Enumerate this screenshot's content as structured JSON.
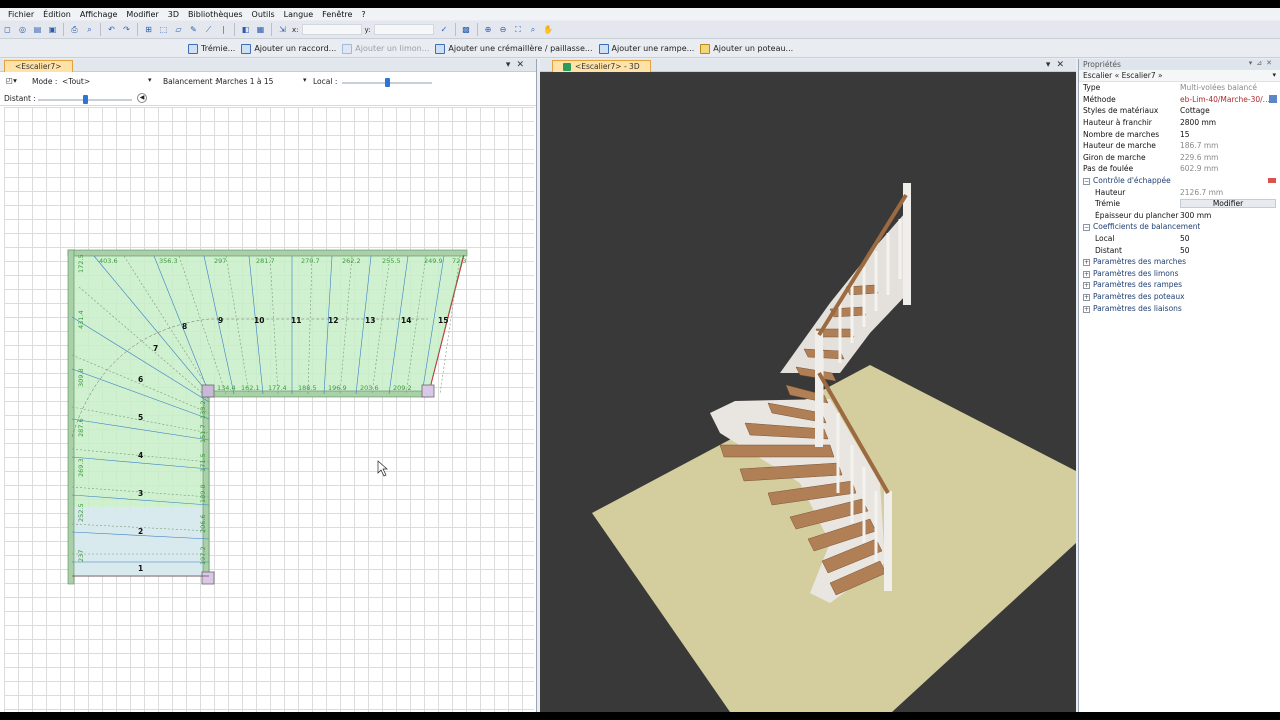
{
  "menu": [
    "Fichier",
    "Édition",
    "Affichage",
    "Modifier",
    "3D",
    "Bibliothèques",
    "Outils",
    "Langue",
    "Fenêtre",
    "?"
  ],
  "toolbar": {
    "x_label": "x:",
    "y_label": "y:"
  },
  "toolbar2": {
    "tremie": "Trémie...",
    "raccord": "Ajouter un raccord...",
    "limon": "Ajouter un limon...",
    "cremaillere": "Ajouter une crémaillère / paillasse...",
    "rampe": "Ajouter une rampe...",
    "poteau": "Ajouter un poteau..."
  },
  "left": {
    "tab": "<Escalier7>",
    "mode_label": "Mode :",
    "mode_value": "<Tout>",
    "balancement_label": "Balancement :",
    "balancement_value": "Marches 1 à 15",
    "local_label": "Local :",
    "distant_label": "Distant :"
  },
  "plan": {
    "step_numbers": [
      "1",
      "2",
      "3",
      "4",
      "5",
      "6",
      "7",
      "8",
      "9",
      "10",
      "11",
      "12",
      "13",
      "14",
      "15"
    ],
    "top_dims": [
      "403.6",
      "356.3",
      "297",
      "281.7",
      "270.7",
      "262.2",
      "255.5",
      "249.9",
      "72.3"
    ],
    "inner_dims": [
      "134.4",
      "162.1",
      "177.4",
      "188.5",
      "196.9",
      "203.6",
      "209.2"
    ],
    "left_dims": [
      "172.5",
      "431.4",
      "309.8",
      "287.6",
      "269.3",
      "252.5",
      "237"
    ],
    "right_dims": [
      "133.2",
      "151.7",
      "171.5",
      "189.8",
      "206.6",
      "197.2"
    ]
  },
  "right": {
    "tab": "<Escalier7> - 3D"
  },
  "props": {
    "title": "Propriétés",
    "selection": "Escalier « Escalier7 »",
    "rows": [
      {
        "k": "Type",
        "v": "Multi-volées balancé",
        "style": "grey"
      },
      {
        "k": "Méthode",
        "v": "eb-Lim-40/Marche-30/...",
        "style": "red"
      },
      {
        "k": "Styles de matériaux",
        "v": "Cottage",
        "style": ""
      },
      {
        "k": "Hauteur à franchir",
        "v": "2800 mm",
        "style": ""
      },
      {
        "k": "Nombre de marches",
        "v": "15",
        "style": ""
      },
      {
        "k": "Hauteur de marche",
        "v": "186.7 mm",
        "style": "grey"
      },
      {
        "k": "Giron de marche",
        "v": "229.6 mm",
        "style": "grey"
      },
      {
        "k": "Pas de foulée",
        "v": "602.9 mm",
        "style": "grey"
      }
    ],
    "sec_tremie": "Contrôle d'échappée",
    "hauteur_k": "Hauteur",
    "hauteur_v": "2126.7 mm",
    "tremie_k": "Trémie",
    "tremie_btn": "Modifier",
    "epaisseur_k": "Épaisseur du plancher",
    "epaisseur_v": "300 mm",
    "sec_coef": "Coefficients de balancement",
    "local_k": "Local",
    "local_v": "50",
    "distant_k": "Distant",
    "distant_v": "50",
    "collapsed": [
      "Paramètres des marches",
      "Paramètres des limons",
      "Paramètres des rampes",
      "Paramètres des poteaux",
      "Paramètres des liaisons"
    ]
  }
}
